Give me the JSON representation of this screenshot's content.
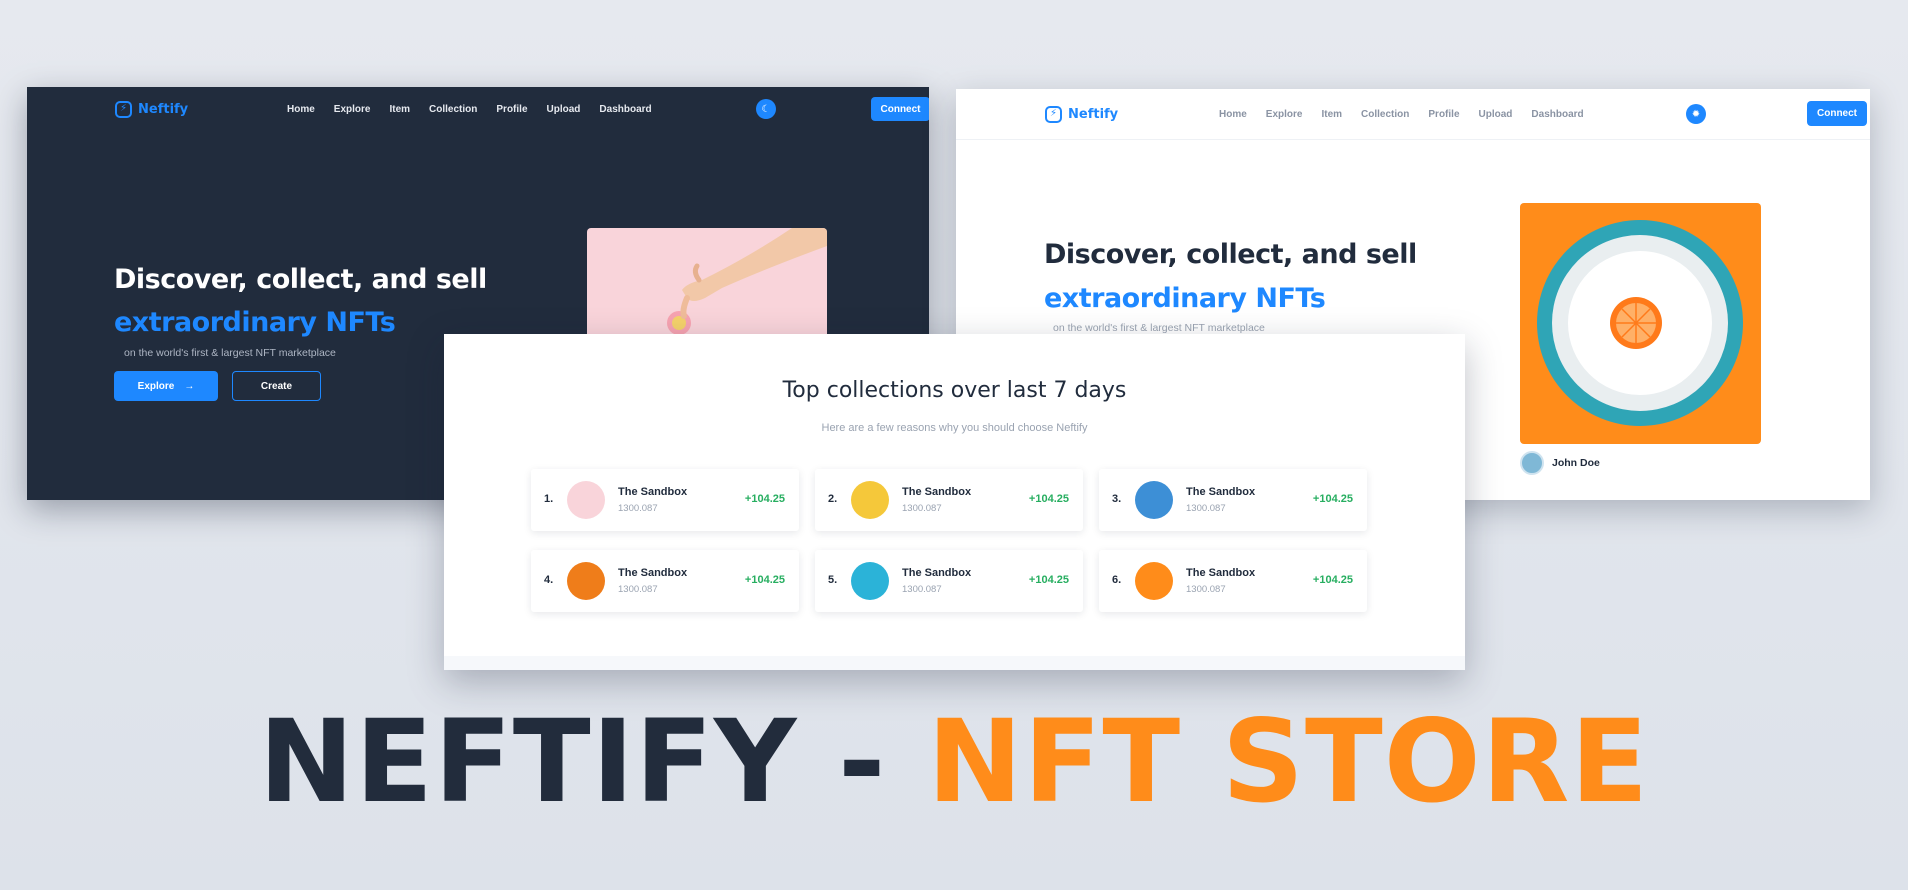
{
  "brand": {
    "name": "Neftify",
    "icon": "bolt-icon",
    "accent": "#1e88ff"
  },
  "nav": {
    "items": [
      "Home",
      "Explore",
      "Item",
      "Collection",
      "Profile",
      "Upload",
      "Dashboard"
    ],
    "connect_label": "Connect",
    "theme_icon_dark": "moon-icon",
    "theme_icon_light": "sun-icon"
  },
  "hero": {
    "heading_line1": "Discover, collect, and sell",
    "heading_line2": "extraordinary NFTs",
    "subtitle": "on the world's first & largest NFT marketplace",
    "explore_label": "Explore",
    "explore_icon": "arrow-right-icon",
    "create_label": "Create",
    "author_name": "John Doe"
  },
  "collections": {
    "title": "Top collections over last 7 days",
    "subtitle": "Here are a few reasons why you should choose Neftify",
    "items": [
      {
        "rank": "1.",
        "name": "The Sandbox",
        "price": "1300.087",
        "change": "+104.25",
        "thumb_color": "#f9d4da"
      },
      {
        "rank": "2.",
        "name": "The Sandbox",
        "price": "1300.087",
        "change": "+104.25",
        "thumb_color": "#f5c83a"
      },
      {
        "rank": "3.",
        "name": "The Sandbox",
        "price": "1300.087",
        "change": "+104.25",
        "thumb_color": "#3d8fd6"
      },
      {
        "rank": "4.",
        "name": "The Sandbox",
        "price": "1300.087",
        "change": "+104.25",
        "thumb_color": "#ef7d1a"
      },
      {
        "rank": "5.",
        "name": "The Sandbox",
        "price": "1300.087",
        "change": "+104.25",
        "thumb_color": "#2bb3d8"
      },
      {
        "rank": "6.",
        "name": "The Sandbox",
        "price": "1300.087",
        "change": "+104.25",
        "thumb_color": "#ff8c1a"
      }
    ],
    "change_color": "#27ae60"
  },
  "banner": {
    "part1": "NEFTIFY -",
    "part2": "NFT STORE",
    "color1": "#222c3c",
    "color2": "#ff8c1a"
  }
}
